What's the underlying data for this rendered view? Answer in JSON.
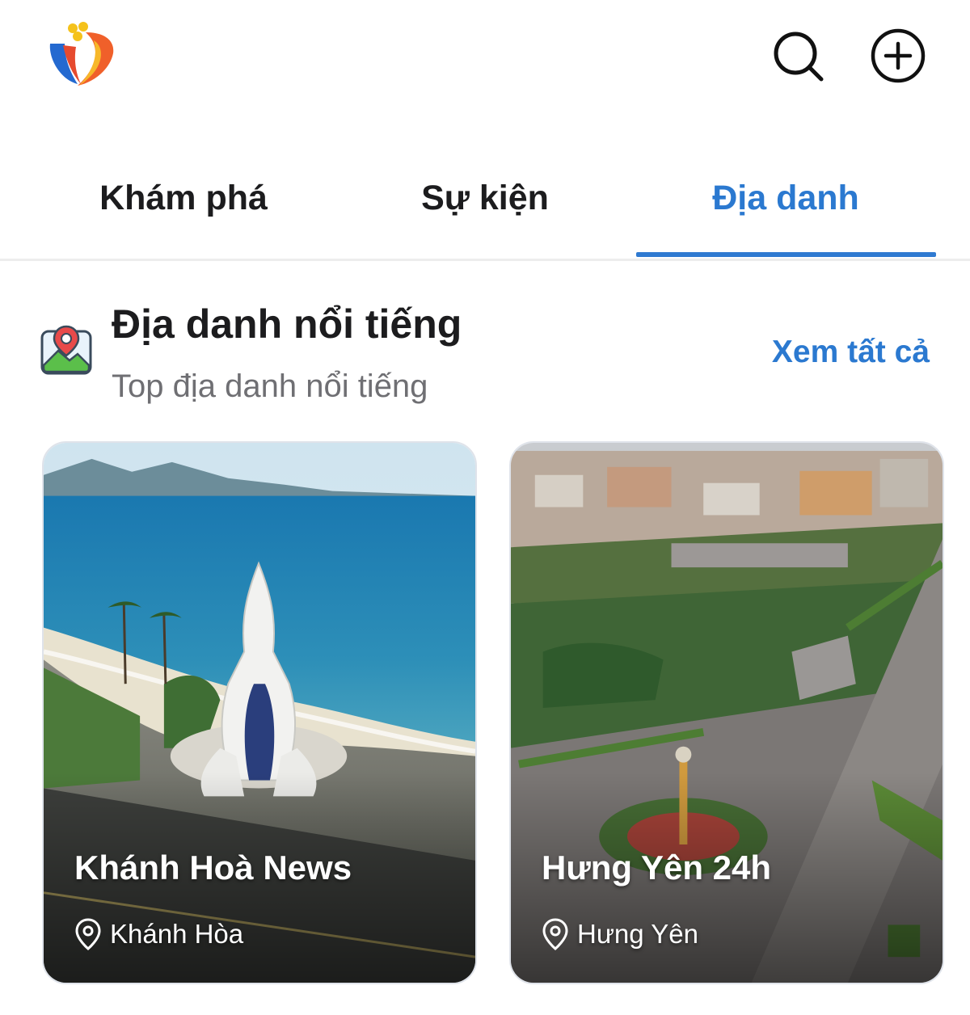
{
  "header": {
    "logo_icon": "app-logo-v",
    "search_icon": "search-icon",
    "add_icon": "plus-circle-icon"
  },
  "tabs": [
    {
      "label": "Khám phá",
      "active": false
    },
    {
      "label": "Sự kiện",
      "active": false
    },
    {
      "label": "Địa danh",
      "active": true
    }
  ],
  "section": {
    "icon": "map-pin-image-icon",
    "title": "Địa danh nổi tiếng",
    "subtitle": "Top địa danh nổi tiếng",
    "see_all": "Xem tất cả"
  },
  "cards": [
    {
      "title": "Khánh Hoà News",
      "location": "Khánh Hòa"
    },
    {
      "title": "Hưng Yên 24h",
      "location": "Hưng Yên"
    }
  ],
  "colors": {
    "accent": "#2b79d0",
    "text": "#1c1c1e",
    "muted": "#6f6f73"
  }
}
